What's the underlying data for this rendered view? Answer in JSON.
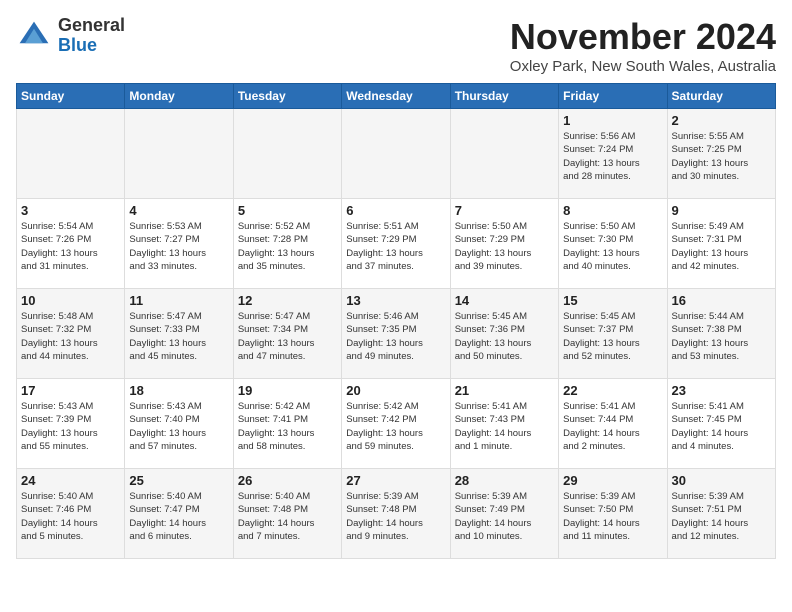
{
  "header": {
    "logo_general": "General",
    "logo_blue": "Blue",
    "month_title": "November 2024",
    "location": "Oxley Park, New South Wales, Australia"
  },
  "days_of_week": [
    "Sunday",
    "Monday",
    "Tuesday",
    "Wednesday",
    "Thursday",
    "Friday",
    "Saturday"
  ],
  "weeks": [
    [
      {
        "day": "",
        "info": ""
      },
      {
        "day": "",
        "info": ""
      },
      {
        "day": "",
        "info": ""
      },
      {
        "day": "",
        "info": ""
      },
      {
        "day": "",
        "info": ""
      },
      {
        "day": "1",
        "info": "Sunrise: 5:56 AM\nSunset: 7:24 PM\nDaylight: 13 hours\nand 28 minutes."
      },
      {
        "day": "2",
        "info": "Sunrise: 5:55 AM\nSunset: 7:25 PM\nDaylight: 13 hours\nand 30 minutes."
      }
    ],
    [
      {
        "day": "3",
        "info": "Sunrise: 5:54 AM\nSunset: 7:26 PM\nDaylight: 13 hours\nand 31 minutes."
      },
      {
        "day": "4",
        "info": "Sunrise: 5:53 AM\nSunset: 7:27 PM\nDaylight: 13 hours\nand 33 minutes."
      },
      {
        "day": "5",
        "info": "Sunrise: 5:52 AM\nSunset: 7:28 PM\nDaylight: 13 hours\nand 35 minutes."
      },
      {
        "day": "6",
        "info": "Sunrise: 5:51 AM\nSunset: 7:29 PM\nDaylight: 13 hours\nand 37 minutes."
      },
      {
        "day": "7",
        "info": "Sunrise: 5:50 AM\nSunset: 7:29 PM\nDaylight: 13 hours\nand 39 minutes."
      },
      {
        "day": "8",
        "info": "Sunrise: 5:50 AM\nSunset: 7:30 PM\nDaylight: 13 hours\nand 40 minutes."
      },
      {
        "day": "9",
        "info": "Sunrise: 5:49 AM\nSunset: 7:31 PM\nDaylight: 13 hours\nand 42 minutes."
      }
    ],
    [
      {
        "day": "10",
        "info": "Sunrise: 5:48 AM\nSunset: 7:32 PM\nDaylight: 13 hours\nand 44 minutes."
      },
      {
        "day": "11",
        "info": "Sunrise: 5:47 AM\nSunset: 7:33 PM\nDaylight: 13 hours\nand 45 minutes."
      },
      {
        "day": "12",
        "info": "Sunrise: 5:47 AM\nSunset: 7:34 PM\nDaylight: 13 hours\nand 47 minutes."
      },
      {
        "day": "13",
        "info": "Sunrise: 5:46 AM\nSunset: 7:35 PM\nDaylight: 13 hours\nand 49 minutes."
      },
      {
        "day": "14",
        "info": "Sunrise: 5:45 AM\nSunset: 7:36 PM\nDaylight: 13 hours\nand 50 minutes."
      },
      {
        "day": "15",
        "info": "Sunrise: 5:45 AM\nSunset: 7:37 PM\nDaylight: 13 hours\nand 52 minutes."
      },
      {
        "day": "16",
        "info": "Sunrise: 5:44 AM\nSunset: 7:38 PM\nDaylight: 13 hours\nand 53 minutes."
      }
    ],
    [
      {
        "day": "17",
        "info": "Sunrise: 5:43 AM\nSunset: 7:39 PM\nDaylight: 13 hours\nand 55 minutes."
      },
      {
        "day": "18",
        "info": "Sunrise: 5:43 AM\nSunset: 7:40 PM\nDaylight: 13 hours\nand 57 minutes."
      },
      {
        "day": "19",
        "info": "Sunrise: 5:42 AM\nSunset: 7:41 PM\nDaylight: 13 hours\nand 58 minutes."
      },
      {
        "day": "20",
        "info": "Sunrise: 5:42 AM\nSunset: 7:42 PM\nDaylight: 13 hours\nand 59 minutes."
      },
      {
        "day": "21",
        "info": "Sunrise: 5:41 AM\nSunset: 7:43 PM\nDaylight: 14 hours\nand 1 minute."
      },
      {
        "day": "22",
        "info": "Sunrise: 5:41 AM\nSunset: 7:44 PM\nDaylight: 14 hours\nand 2 minutes."
      },
      {
        "day": "23",
        "info": "Sunrise: 5:41 AM\nSunset: 7:45 PM\nDaylight: 14 hours\nand 4 minutes."
      }
    ],
    [
      {
        "day": "24",
        "info": "Sunrise: 5:40 AM\nSunset: 7:46 PM\nDaylight: 14 hours\nand 5 minutes."
      },
      {
        "day": "25",
        "info": "Sunrise: 5:40 AM\nSunset: 7:47 PM\nDaylight: 14 hours\nand 6 minutes."
      },
      {
        "day": "26",
        "info": "Sunrise: 5:40 AM\nSunset: 7:48 PM\nDaylight: 14 hours\nand 7 minutes."
      },
      {
        "day": "27",
        "info": "Sunrise: 5:39 AM\nSunset: 7:48 PM\nDaylight: 14 hours\nand 9 minutes."
      },
      {
        "day": "28",
        "info": "Sunrise: 5:39 AM\nSunset: 7:49 PM\nDaylight: 14 hours\nand 10 minutes."
      },
      {
        "day": "29",
        "info": "Sunrise: 5:39 AM\nSunset: 7:50 PM\nDaylight: 14 hours\nand 11 minutes."
      },
      {
        "day": "30",
        "info": "Sunrise: 5:39 AM\nSunset: 7:51 PM\nDaylight: 14 hours\nand 12 minutes."
      }
    ]
  ]
}
